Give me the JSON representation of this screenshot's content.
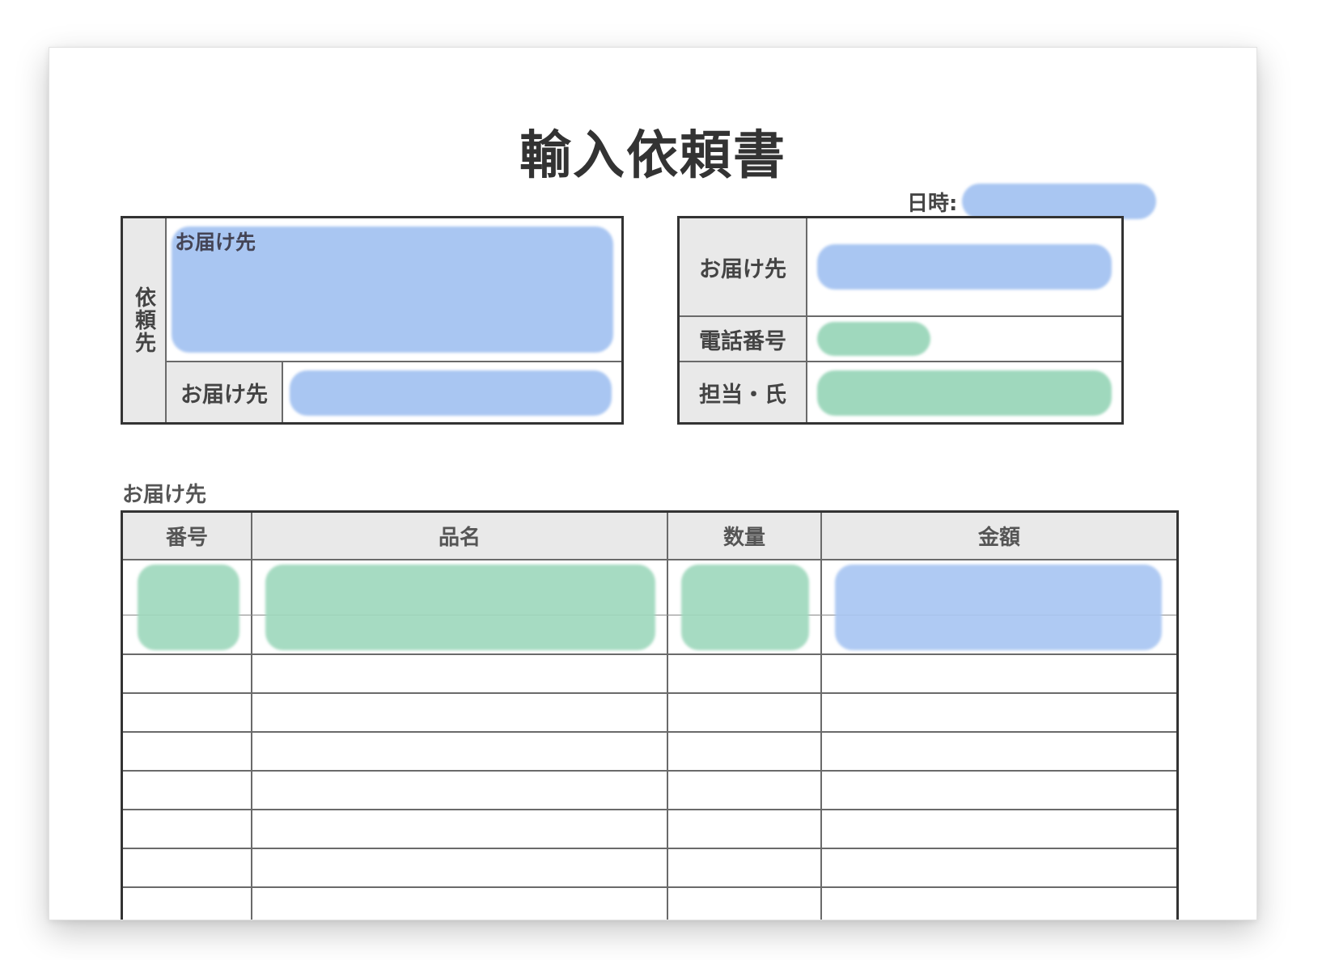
{
  "document": {
    "title": "輸入依頼書",
    "date_label": "日時:"
  },
  "left_box": {
    "side_label": "依頼先",
    "inner_label": "お届け先",
    "bottom_label": "お届け先"
  },
  "right_box": {
    "rows": [
      {
        "label": "お届け先"
      },
      {
        "label": "電話番号"
      },
      {
        "label": "担当・氏"
      }
    ]
  },
  "items_section": {
    "label": "お届け先",
    "columns": [
      "番号",
      "品名",
      "数量",
      "金額"
    ]
  },
  "colors": {
    "blue_field": "#a9c6f2",
    "green_field": "#9fd8bd",
    "header_bg": "#e9e9e9",
    "border": "#333333"
  }
}
